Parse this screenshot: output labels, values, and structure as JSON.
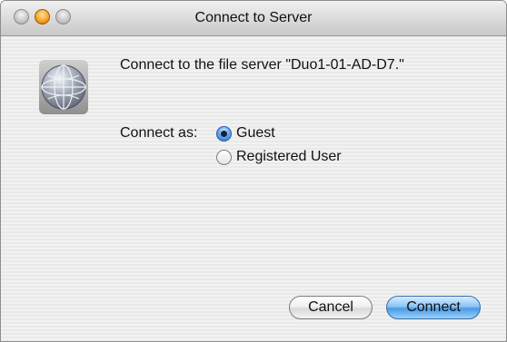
{
  "window": {
    "title": "Connect to Server"
  },
  "dialog": {
    "icon": "globe-network-icon",
    "message": "Connect to the file server \"Duo1-01-AD-D7.\"",
    "connect_as_label": "Connect as:",
    "options": [
      {
        "label": "Guest",
        "selected": true
      },
      {
        "label": "Registered User",
        "selected": false
      }
    ]
  },
  "buttons": {
    "cancel_label": "Cancel",
    "connect_label": "Connect"
  },
  "colors": {
    "default_button": "#4a9ae6",
    "minimize_light": "#f3a020"
  }
}
